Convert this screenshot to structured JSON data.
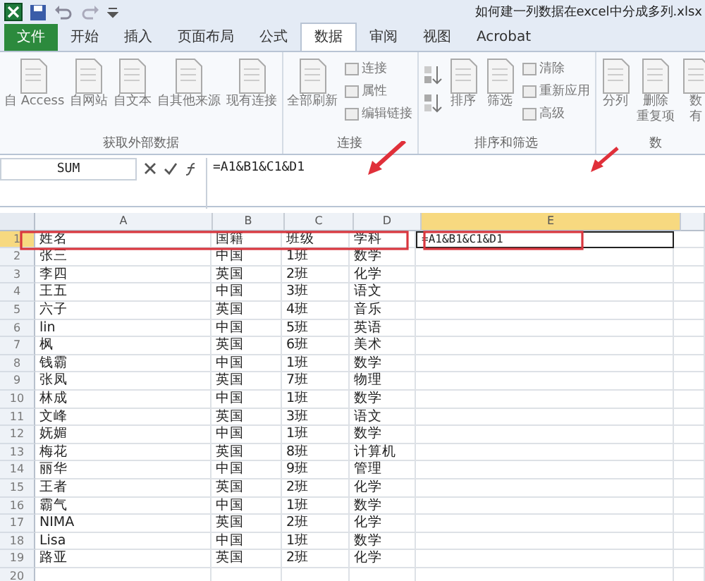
{
  "window": {
    "title": "如何建一列数据在excel中分成多列.xlsx"
  },
  "tabs": [
    {
      "label": "文件",
      "kind": "file",
      "selected": false
    },
    {
      "label": "开始",
      "kind": "tab",
      "selected": false
    },
    {
      "label": "插入",
      "kind": "tab",
      "selected": false
    },
    {
      "label": "页面布局",
      "kind": "tab",
      "selected": false
    },
    {
      "label": "公式",
      "kind": "tab",
      "selected": false
    },
    {
      "label": "数据",
      "kind": "tab",
      "selected": true
    },
    {
      "label": "审阅",
      "kind": "tab",
      "selected": false
    },
    {
      "label": "视图",
      "kind": "tab",
      "selected": false
    },
    {
      "label": "Acrobat",
      "kind": "tab",
      "selected": false
    }
  ],
  "ribbon_groups": [
    {
      "label": "获取外部数据",
      "items": [
        {
          "kind": "large",
          "lines": [
            "自 Access"
          ]
        },
        {
          "kind": "large",
          "lines": [
            "自网站"
          ]
        },
        {
          "kind": "large",
          "lines": [
            "自文本"
          ]
        },
        {
          "kind": "large",
          "lines": [
            "自其他来源"
          ]
        },
        {
          "kind": "large",
          "lines": [
            "现有连接"
          ]
        }
      ]
    },
    {
      "label": "连接",
      "items": [
        {
          "kind": "large",
          "lines": [
            "全部刷新"
          ]
        },
        {
          "kind": "stack",
          "lines": [
            "连接",
            "属性",
            "编辑链接"
          ]
        }
      ]
    },
    {
      "label": "排序和筛选",
      "items": [
        {
          "kind": "sort"
        },
        {
          "kind": "large",
          "lines": [
            "排序"
          ]
        },
        {
          "kind": "large",
          "lines": [
            "筛选"
          ]
        },
        {
          "kind": "stack",
          "lines": [
            "清除",
            "重新应用",
            "高级"
          ]
        }
      ]
    },
    {
      "label": "数",
      "items": [
        {
          "kind": "large",
          "lines": [
            "分列"
          ]
        },
        {
          "kind": "large",
          "lines": [
            "删除",
            "重复项"
          ]
        },
        {
          "kind": "large",
          "lines": [
            "数",
            "有"
          ]
        }
      ]
    }
  ],
  "formula_bar": {
    "name_box": "SUM",
    "formula": "=A1&B1&C1&D1"
  },
  "sheet": {
    "columns": [
      "A",
      "B",
      "C",
      "D",
      "E"
    ],
    "rows": [
      {
        "number": "1",
        "cells": [
          "姓名",
          "国籍",
          "班级",
          "学科"
        ],
        "editing": "=A1&B1&C1&D1"
      },
      {
        "number": "2",
        "cells": [
          "张三",
          "中国",
          "1班",
          "数学"
        ]
      },
      {
        "number": "3",
        "cells": [
          "李四",
          "英国",
          "2班",
          "化学"
        ]
      },
      {
        "number": "4",
        "cells": [
          "王五",
          "中国",
          "3班",
          "语文"
        ]
      },
      {
        "number": "5",
        "cells": [
          "六子",
          "英国",
          "4班",
          "音乐"
        ]
      },
      {
        "number": "6",
        "cells": [
          "lin",
          "中国",
          "5班",
          "英语"
        ]
      },
      {
        "number": "7",
        "cells": [
          "枫",
          "英国",
          "6班",
          "美术"
        ]
      },
      {
        "number": "8",
        "cells": [
          "钱霸",
          "中国",
          "1班",
          "数学"
        ]
      },
      {
        "number": "9",
        "cells": [
          "张凤",
          "英国",
          "7班",
          "物理"
        ]
      },
      {
        "number": "10",
        "cells": [
          "林成",
          "中国",
          "1班",
          "数学"
        ]
      },
      {
        "number": "11",
        "cells": [
          "文峰",
          "英国",
          "3班",
          "语文"
        ]
      },
      {
        "number": "12",
        "cells": [
          "妩媚",
          "中国",
          "1班",
          "数学"
        ]
      },
      {
        "number": "13",
        "cells": [
          "梅花",
          "英国",
          "8班",
          "计算机"
        ]
      },
      {
        "number": "14",
        "cells": [
          "丽华",
          "中国",
          "9班",
          "管理"
        ]
      },
      {
        "number": "15",
        "cells": [
          "王者",
          "英国",
          "2班",
          "化学"
        ]
      },
      {
        "number": "16",
        "cells": [
          "霸气",
          "中国",
          "1班",
          "数学"
        ]
      },
      {
        "number": "17",
        "cells": [
          "NIMA",
          "英国",
          "2班",
          "化学"
        ]
      },
      {
        "number": "18",
        "cells": [
          "Lisa",
          "中国",
          "1班",
          "数学"
        ]
      },
      {
        "number": "19",
        "cells": [
          "路亚",
          "英国",
          "2班",
          "化学"
        ]
      },
      {
        "number": "20",
        "cells": [
          "",
          "",
          "",
          ""
        ]
      }
    ]
  }
}
